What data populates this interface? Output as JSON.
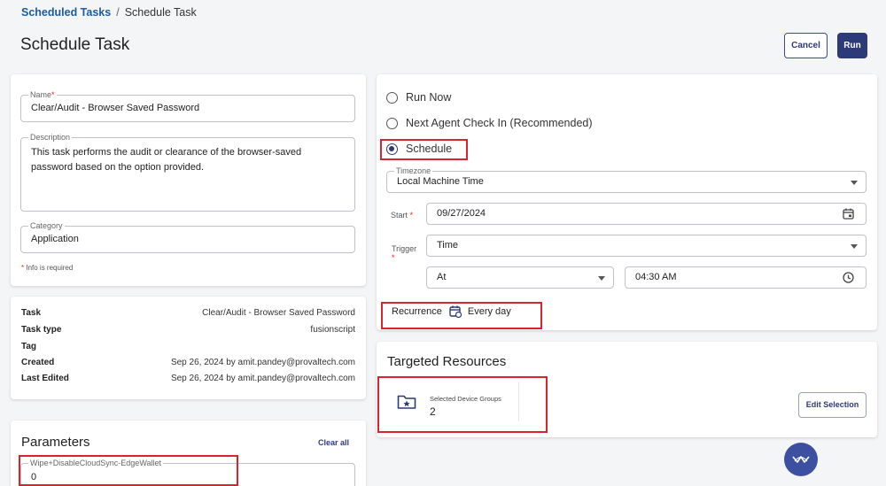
{
  "breadcrumb": {
    "parent": "Scheduled Tasks",
    "separator": "/",
    "current": "Schedule Task"
  },
  "page": {
    "title": "Schedule Task"
  },
  "header": {
    "cancel_label": "Cancel",
    "run_label": "Run"
  },
  "details": {
    "name_label": "Name",
    "name_value": "Clear/Audit - Browser Saved Password",
    "description_label": "Description",
    "description_value": "This task performs the audit or clearance of the browser-saved password based on the option provided.",
    "category_label": "Category",
    "category_value": "Application",
    "required_note": "Info is required",
    "required_mark": "*"
  },
  "info": {
    "rows": [
      {
        "key": "Task",
        "value": "Clear/Audit - Browser Saved Password"
      },
      {
        "key": "Task type",
        "value": "fusionscript"
      },
      {
        "key": "Tag",
        "value": ""
      },
      {
        "key": "Created",
        "value": "Sep 26, 2024 by amit.pandey@provaltech.com"
      },
      {
        "key": "Last Edited",
        "value": "Sep 26, 2024 by amit.pandey@provaltech.com"
      }
    ]
  },
  "parameters": {
    "title": "Parameters",
    "clear_all_label": "Clear all",
    "field_label": "Wipe+DisableCloudSync-EdgeWallet",
    "field_value": "0"
  },
  "schedule": {
    "options": [
      {
        "label": "Run Now",
        "checked": false
      },
      {
        "label": "Next Agent Check In (Recommended)",
        "checked": false
      },
      {
        "label": "Schedule",
        "checked": true
      }
    ],
    "timezone_label": "Timezone",
    "timezone_value": "Local Machine Time",
    "start_label": "Start",
    "start_value": "09/27/2024",
    "trigger_label": "Trigger",
    "trigger_value": "Time",
    "at_value": "At",
    "time_value": "04:30 AM",
    "recurrence_label": "Recurrence",
    "recurrence_value": "Every day"
  },
  "targeted": {
    "title": "Targeted Resources",
    "group_label": "Selected Device Groups",
    "group_count": "2",
    "edit_label": "Edit Selection"
  },
  "colors": {
    "primary": "#2d3a7a",
    "link": "#1e5a9c",
    "highlight": "#d9232e",
    "required": "#dd2222"
  },
  "icons": [
    "calendar-icon",
    "clock-icon",
    "recurrence-calendar-icon",
    "star-folder-icon",
    "caret-down-icon",
    "assistant-fab-icon"
  ]
}
